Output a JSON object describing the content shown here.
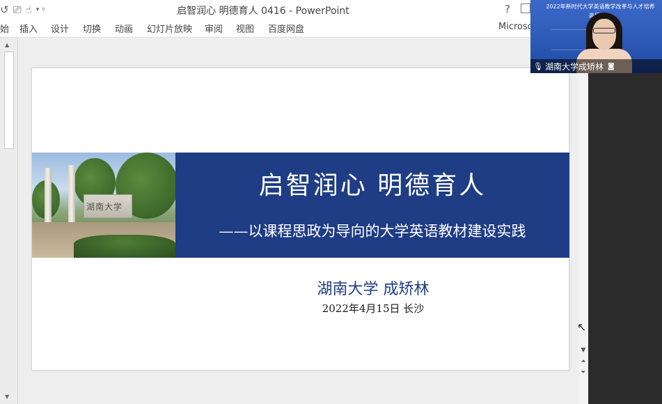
{
  "window": {
    "title": "启智润心 明德育人 0416 - PowerPoint",
    "help": "?"
  },
  "qat": {
    "undo_icon": "↺",
    "slideshow_icon": "⎚",
    "touch_icon": "☝",
    "dropdown_icon": "▾",
    "customize_icon": "▿"
  },
  "ribbon": {
    "tabs": [
      "始",
      "插入",
      "设计",
      "切换",
      "动画",
      "幻灯片放映",
      "审阅",
      "视图",
      "百度网盘"
    ],
    "account": "Microso"
  },
  "slide": {
    "photo_inscription": "湖南大学",
    "main_title": "启智润心  明德育人",
    "subtitle": "——以课程思政为导向的大学英语教材建设实践",
    "author": "湖南大学  成矫林",
    "date_place": "2022年4月15日  长沙"
  },
  "video": {
    "header_line1": "2022年新时代大学英语教学改革与人才培养",
    "header_line2": "高层",
    "participant_name": "湖南大学成矫林"
  },
  "colors": {
    "banner": "#1f3d84",
    "author_text": "#1f3d84"
  }
}
